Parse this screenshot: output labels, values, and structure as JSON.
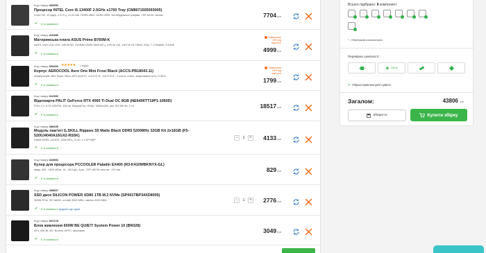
{
  "items": [
    {
      "code_label": "Код товару",
      "code": "400550",
      "title": "Процесор INTEL Core i5-13400F 2.5GHz s1700 Tray (CM8071505093005)",
      "specs": "LGA1700, 10 ядер, 2.5 ГГц, L3 20 МБ, DDR5-4800, DDR4-3200, без вбудованої графіки, TDP 65 Вт, чисник",
      "stock": "Є в наявності",
      "price": "7704",
      "currency": "грн"
    },
    {
      "code_label": "Код товару",
      "code": "410486",
      "title": "Материнська плата ASUS Prime B760M-K",
      "specs": "mATX, Intel LGA 1700, Intel B760, 2xDIMM DDR5-5600 МГц, 1xPCIe x16, 2xPCIe x4, HDMI, VGA, 7.1 Realtek, 2.5GbE",
      "stock": "Є в наявності",
      "price": "4999",
      "currency": "грн",
      "promo_line1": "Повернемо",
      "promo_line2": "10% від",
      "promo_line3": "вартості"
    },
    {
      "code_label": "Код товару",
      "code": "393403",
      "title": "Корпус AEROCOOL Aero One Mini Frost Black (ACCS-PB18043.11)",
      "specs": "геймерський, Mini Tower, Micro-ATX (mATX), 1x3.5\"/2.5\", 1x3.5\"/2.5\", 4 слоти, сталь, загартоване скло, 5.38 кг",
      "stars": "★★★★★",
      "reviews": "1 відгук",
      "stock": "Є в наявності",
      "price": "1799",
      "currency": "грн",
      "promo_line1": "Повернемо",
      "promo_line2": "10% від",
      "promo_line3": "вартості"
    },
    {
      "code_label": "Код товару",
      "code": "412360",
      "title": "Відеокарта PALIT GeForce RTX 4060 Ti Dual OC 8GB (NE6406TT19P1-1060D)",
      "specs": "PCIe 4.0, 8 ГБ GDDR6, 128-bit, DisplayPort, HDMI, 7680x4320, рек. БП 650 Вт, 2 сл.",
      "stock": "Є в наявності",
      "price": "18517",
      "currency": "грн"
    },
    {
      "code_label": "Код товару",
      "code": "386605",
      "title": "Модуль пам'яті G.SKILL Ripjaws S5 Matte Black DDR5 5200MHz 32GB Kit 2x16GB (F5-5200J4040A16GX2-RS5K)",
      "title_line1": "Модуль пам'яті G.SKILL Ripjaws S5 Matte Black DDR5 5200MHz 32GB Kit 2x16GB (F5-",
      "title_line2": "5200J4040A16GX2-RS5K)",
      "specs": "DIMM DDR5, 2x16ГБ, 5200 МГц, CL40, 1.1 В**XMP",
      "stock": "Є в наявності",
      "qty": "1",
      "price": "4133",
      "currency": "грн"
    },
    {
      "code_label": "Код товару",
      "code": "416853",
      "title": "Кулер для процесора PCCOOLER Paladin EX400 (R3-K410WBKNYX-GL)",
      "specs": "медь, 400...1800 об/хв, 16...28.6 дБ, 4-pin, TDP 180 Вт, висота - 157 мм",
      "stock": "Є в наявності",
      "price": "829",
      "currency": "грн"
    },
    {
      "code_label": "Код товару",
      "code": "408837",
      "title": "SSD диск SILICON POWER XD80 1TB M.2 NVMe (SP001TBP34XD8005)",
      "specs": "NVMe PCIe, 3D NAND, чтение 3400 МБ/с, запись 3000 МБ/с",
      "stock": "Є в наявності",
      "add_link": "Додати ще один",
      "qty": "1",
      "price": "2776",
      "currency": "грн"
    },
    {
      "code_label": "Код товару",
      "code": "397278",
      "title": "Блок живлення 650W BE QUIET! System Power 10 (BN328)",
      "specs": "ATX, 650 Вт, 80+ Bronze, APFC, фіксовані",
      "stock": "Є в наявності",
      "price": "3049",
      "currency": "грн"
    }
  ],
  "summary": {
    "selected_prefix": "Всього підібрано:",
    "selected_count": "8",
    "selected_suffix": "компонент",
    "obligatory_note": "* - Обов'язкові комплектуючі",
    "compat_title": "Перевірка сумісності:",
    "compat_power": "326 W",
    "compat_ok": "Обрані комплектуючі сумісні",
    "total_label": "Загалом:",
    "total_value": "43806",
    "total_currency": "грн",
    "save_label": "Зберегти",
    "buy_label": "Купити збірку"
  },
  "colors": {
    "accent_green": "#3bb54a",
    "delete_orange": "#f26a1b",
    "swap_blue": "#2f77c9"
  }
}
